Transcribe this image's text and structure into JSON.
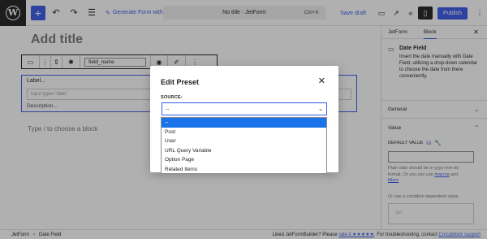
{
  "topbar": {
    "wp_logo": "W",
    "add_symbol": "+",
    "generate_label": "Generate Form with AI",
    "doc_title": "No title · JetForm",
    "shortcut": "Ctrl+K",
    "save_draft": "Save draft",
    "publish": "Publish",
    "accent_color": "#3858e9"
  },
  "editor": {
    "title_placeholder": "Add title",
    "toolbar_field_name": "field_name",
    "field": {
      "label": "Label...",
      "input_placeholder": "input type=\"date\"",
      "description": "Description..."
    },
    "choose_block": "Type / to choose a block"
  },
  "sidebar": {
    "tabs": [
      "JetForm",
      "Block"
    ],
    "block_name": "Date Field",
    "block_desc": "Insert the date manually with Date Field, utilizing a drop-down calendar to choose the date from there conveniently.",
    "panel_general": "General",
    "panel_value": "Value",
    "default_value_label": "DEFAULT VALUE",
    "help_text": "Plain date should be in yyyy-mm-dd format. Or you can use",
    "help_link_macros": "macros",
    "help_and": "and",
    "help_link_filters": "filters",
    "or_text": "Or use a condition dependent value",
    "cond_placeholder": "Set"
  },
  "statusbar": {
    "crumbs": [
      "JetForm",
      "Date Field"
    ],
    "message_prefix": "Liked JetFormBuilder? Please",
    "message_link": "rate it ★★★★★",
    "message_suffix": ". For troubleshooting, contact",
    "support_link": "Crocoblock support"
  },
  "modal": {
    "title": "Edit Preset",
    "source_label": "Source:",
    "selected_value": "--",
    "options": [
      "--",
      "Post",
      "User",
      "URL Query Variable",
      "Option Page",
      "Related Items"
    ]
  }
}
